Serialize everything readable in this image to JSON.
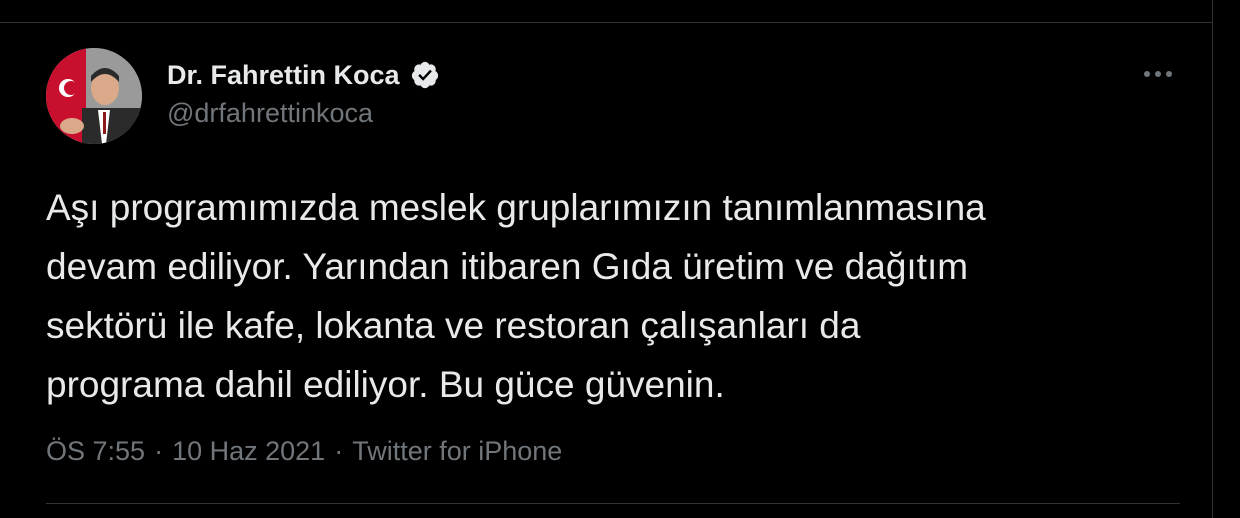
{
  "author": {
    "display_name": "Dr. Fahrettin Koca",
    "handle": "@drfahrettinkoca",
    "verified": true
  },
  "tweet": {
    "text": "Aşı programımızda meslek gruplarımızın tanımlanmasına\ndevam ediliyor. Yarından itibaren Gıda üretim ve dağıtım\nsektörü ile kafe, lokanta ve restoran çalışanları da\nprograma dahil ediliyor. Bu güce güvenin."
  },
  "meta": {
    "time": "ÖS 7:55",
    "separator": "·",
    "date": "10 Haz 2021",
    "client": "Twitter for iPhone"
  },
  "icons": {
    "verified": "verified-badge-icon",
    "more": "more-options-icon"
  },
  "colors": {
    "background": "#000000",
    "primary_text": "#e7e9ea",
    "secondary_text": "#71767b",
    "divider": "#2f3336"
  }
}
